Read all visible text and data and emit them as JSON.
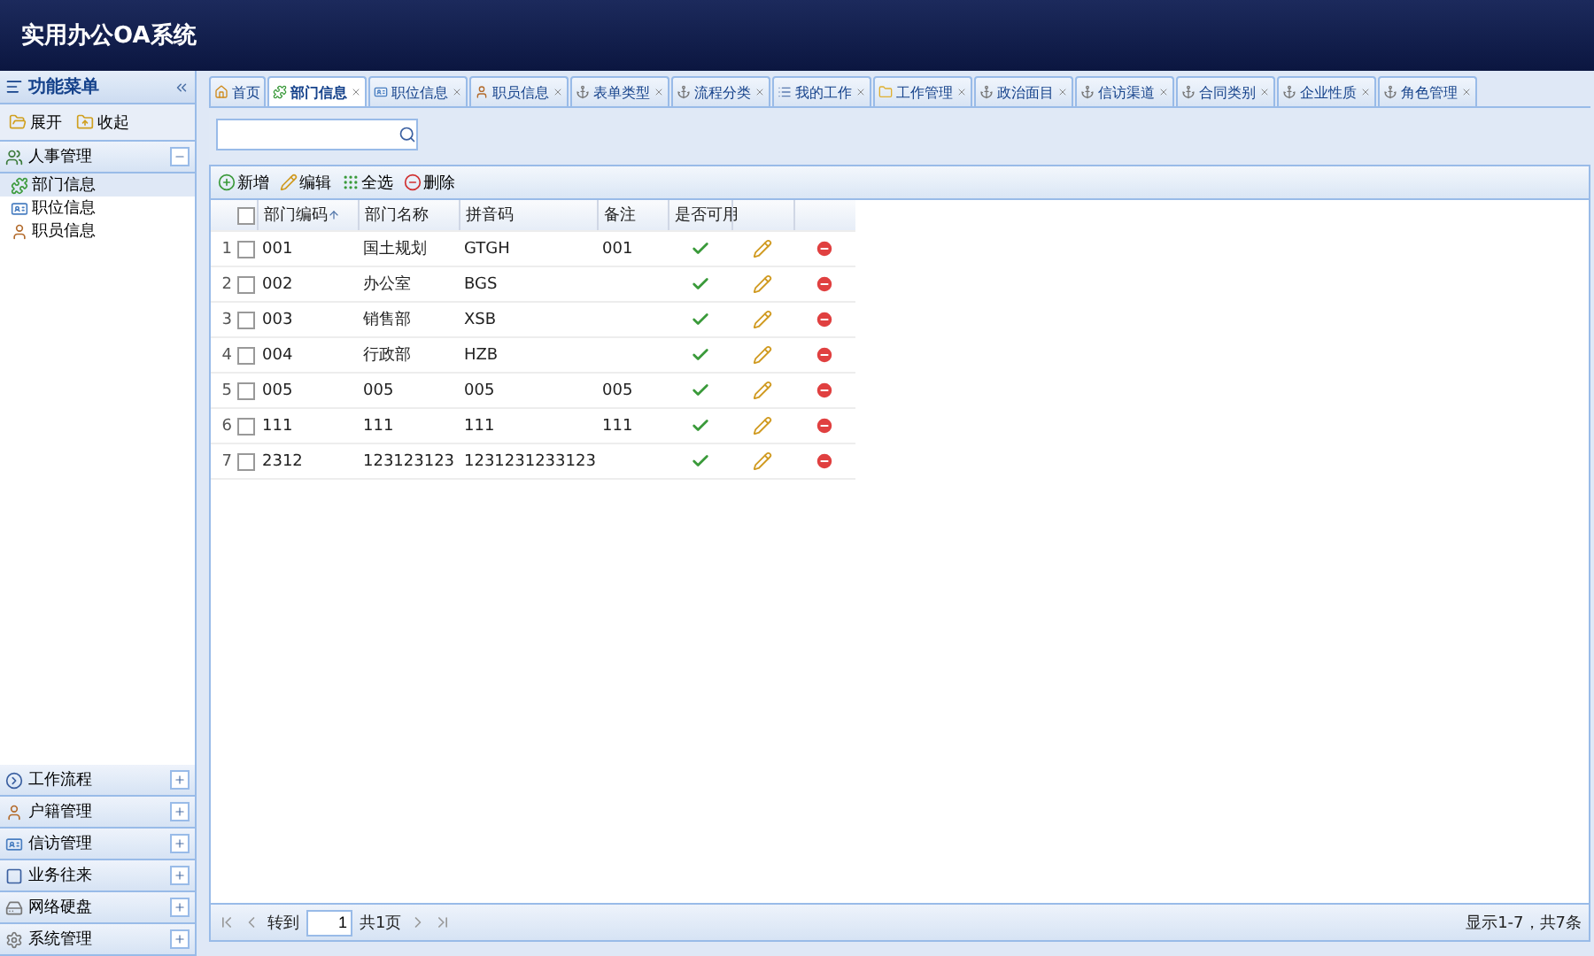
{
  "header": {
    "title": "实用办公OA系统"
  },
  "sidebar": {
    "title": "功能菜单",
    "actions": [
      {
        "kind": "expand",
        "label": "展开"
      },
      {
        "kind": "collapse",
        "label": "收起"
      }
    ],
    "groups": [
      {
        "label": "人事管理",
        "expanded": true,
        "items": [
          {
            "label": "部门信息",
            "selected": true
          },
          {
            "label": "职位信息",
            "selected": false
          },
          {
            "label": "职员信息",
            "selected": false
          }
        ]
      },
      {
        "label": "工作流程",
        "expanded": false
      },
      {
        "label": "户籍管理",
        "expanded": false
      },
      {
        "label": "信访管理",
        "expanded": false
      },
      {
        "label": "业务往来",
        "expanded": false
      },
      {
        "label": "网络硬盘",
        "expanded": false
      },
      {
        "label": "系统管理",
        "expanded": false
      }
    ]
  },
  "tabs": [
    {
      "label": "首页",
      "selected": false
    },
    {
      "label": "部门信息",
      "selected": true
    },
    {
      "label": "职位信息",
      "selected": false
    },
    {
      "label": "职员信息",
      "selected": false
    },
    {
      "label": "表单类型",
      "selected": false
    },
    {
      "label": "流程分类",
      "selected": false
    },
    {
      "label": "我的工作",
      "selected": false
    },
    {
      "label": "工作管理",
      "selected": false
    },
    {
      "label": "政治面目",
      "selected": false
    },
    {
      "label": "信访渠道",
      "selected": false
    },
    {
      "label": "合同类别",
      "selected": false
    },
    {
      "label": "企业性质",
      "selected": false
    },
    {
      "label": "角色管理",
      "selected": false
    }
  ],
  "toolbar": [
    {
      "kind": "add",
      "label": "新增"
    },
    {
      "kind": "edit",
      "label": "编辑"
    },
    {
      "kind": "select_all",
      "label": "全选"
    },
    {
      "kind": "delete",
      "label": "删除"
    }
  ],
  "table": {
    "all_checked": false,
    "columns": [
      "部门编码",
      "部门名称",
      "拼音码",
      "备注",
      "是否可用"
    ],
    "rows": [
      {
        "num": "1",
        "checked": false,
        "code": "001",
        "name": "国土规划",
        "pinyin": "GTGH",
        "note": "001",
        "enabled": true
      },
      {
        "num": "2",
        "checked": false,
        "code": "002",
        "name": "办公室",
        "pinyin": "BGS",
        "note": "",
        "enabled": true
      },
      {
        "num": "3",
        "checked": false,
        "code": "003",
        "name": "销售部",
        "pinyin": "XSB",
        "note": "",
        "enabled": true
      },
      {
        "num": "4",
        "checked": false,
        "code": "004",
        "name": "行政部",
        "pinyin": "HZB",
        "note": "",
        "enabled": true
      },
      {
        "num": "5",
        "checked": false,
        "code": "005",
        "name": "005",
        "pinyin": "005",
        "note": "005",
        "enabled": true
      },
      {
        "num": "6",
        "checked": false,
        "code": "111",
        "name": "111",
        "pinyin": "111",
        "note": "111",
        "enabled": true
      },
      {
        "num": "7",
        "checked": false,
        "code": "2312",
        "name": "123123123",
        "pinyin": "1231231233123",
        "note": "",
        "enabled": true
      }
    ]
  },
  "pager": {
    "goto_label": "转到",
    "page": "1",
    "total_pages": "共1页",
    "summary": "显示1-7，共7条"
  }
}
